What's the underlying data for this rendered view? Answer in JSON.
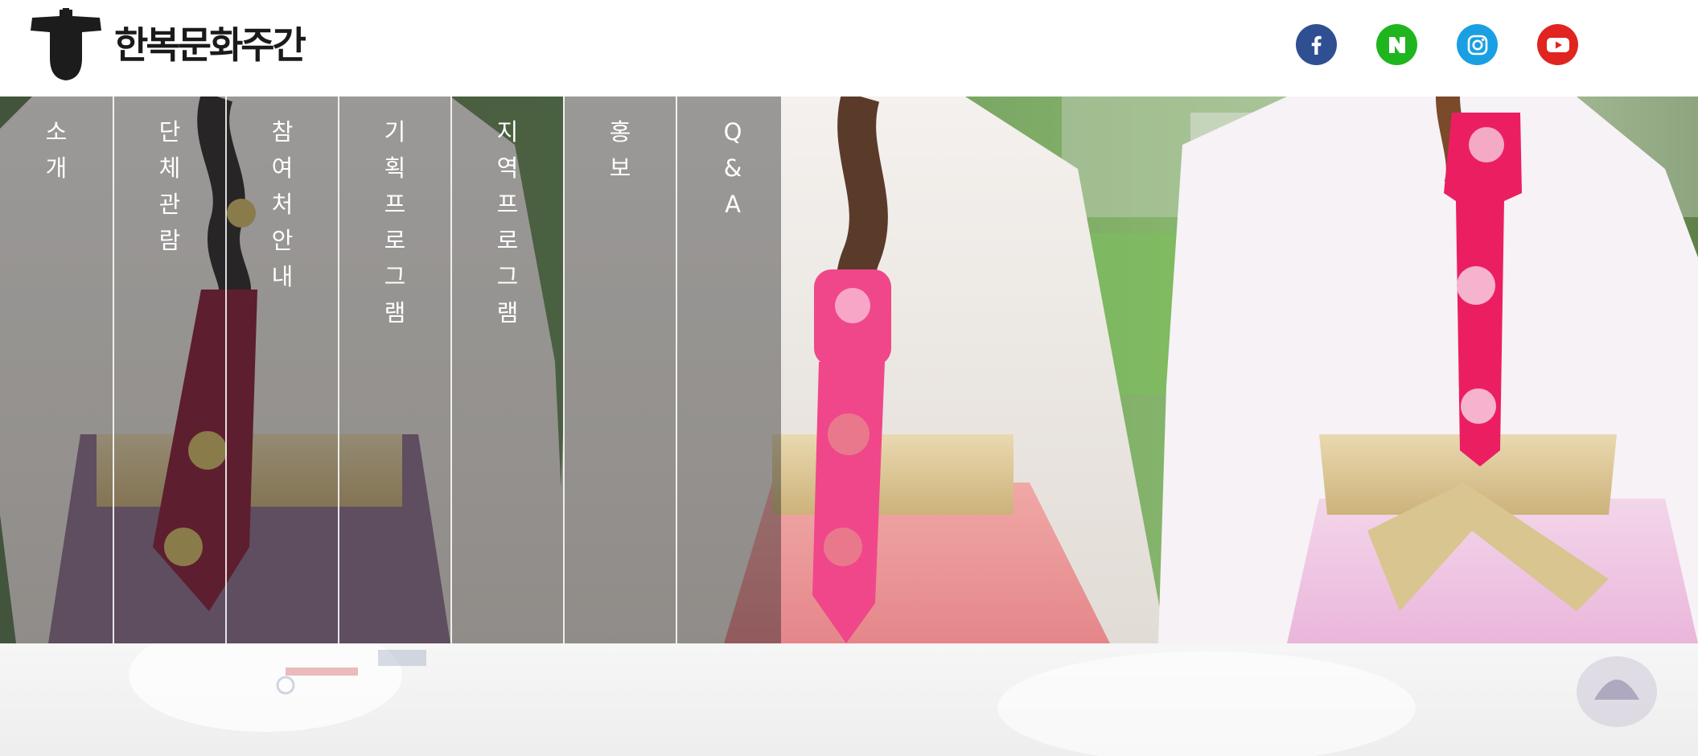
{
  "header": {
    "logo_text": "한복문화주간",
    "social": [
      {
        "name": "facebook",
        "icon": "facebook-icon",
        "color": "#3b5998"
      },
      {
        "name": "naver",
        "icon": "naver-icon",
        "color": "#1ec800"
      },
      {
        "name": "instagram",
        "icon": "instagram-icon",
        "color": "#1b9fe0"
      },
      {
        "name": "youtube",
        "icon": "youtube-icon",
        "color": "#e62117"
      }
    ]
  },
  "nav": {
    "items": [
      {
        "label": "소개"
      },
      {
        "label": "단체관람"
      },
      {
        "label": "참여처안내"
      },
      {
        "label": "기획프로그램"
      },
      {
        "label": "지역프로그램"
      },
      {
        "label": "홍보"
      },
      {
        "label": "Q&A"
      }
    ]
  },
  "colors": {
    "header_bg": "#ffffff",
    "logo_text": "#1a1a1a",
    "nav_overlay": "rgba(30,30,30,0.42)",
    "nav_text": "#ffffff",
    "hero_grass": "#7ea86a"
  }
}
